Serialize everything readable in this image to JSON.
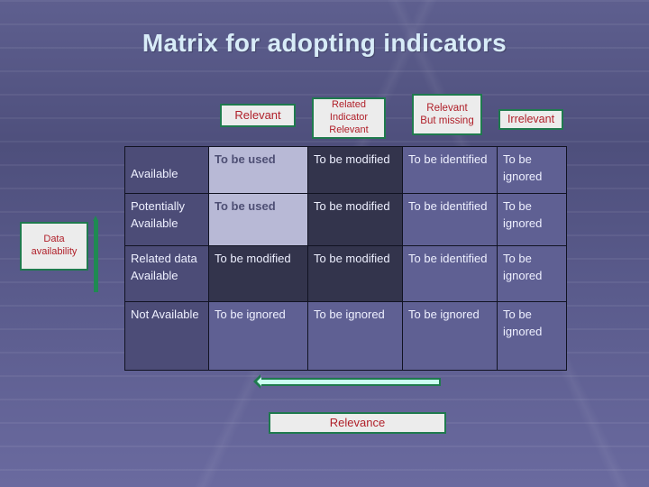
{
  "title": "Matrix for adopting indicators",
  "column_headers": [
    "Relevant",
    "Related Indicator Relevant",
    "Relevant But missing",
    "Irrelevant"
  ],
  "column_header_lines": {
    "related": [
      "Related",
      "Indicator",
      "Relevant"
    ],
    "missing": [
      "Relevant",
      "But missing"
    ]
  },
  "rows": [
    {
      "label": "Available",
      "cells": [
        "To be used",
        "To be modified",
        "To be identified",
        "To be ignored"
      ]
    },
    {
      "label": "Potentially Available",
      "cells": [
        "To be used",
        "To be modified",
        "To be identified",
        "To be ignored"
      ]
    },
    {
      "label": "Related data Available",
      "cells": [
        "To be modified",
        "To be modified",
        "To be identified",
        "To be ignored"
      ]
    },
    {
      "label": "Not Available",
      "cells": [
        "To be ignored",
        "To be ignored",
        "To be ignored",
        "To be ignored"
      ]
    }
  ],
  "row_label_lines": {
    "potentially": [
      "Potentially",
      "Available"
    ],
    "related": [
      "Related data",
      "Available"
    ]
  },
  "axes": {
    "vertical_label": "Data availability",
    "vertical_label_lines": [
      "Data",
      "availability"
    ],
    "horizontal_label": "Relevance",
    "vertical_arrow_direction": "up",
    "horizontal_arrow_direction": "left"
  },
  "colors": {
    "label_box_bg": "#ececec",
    "label_box_border": "#1f7a4e",
    "label_text": "#b0202a",
    "title_text": "#d8ecf8",
    "cell_used": "#b8b9d6",
    "cell_dark": "#33344c",
    "cell_mid": "#5f6093",
    "arrow_fill": "#c9fff0"
  }
}
